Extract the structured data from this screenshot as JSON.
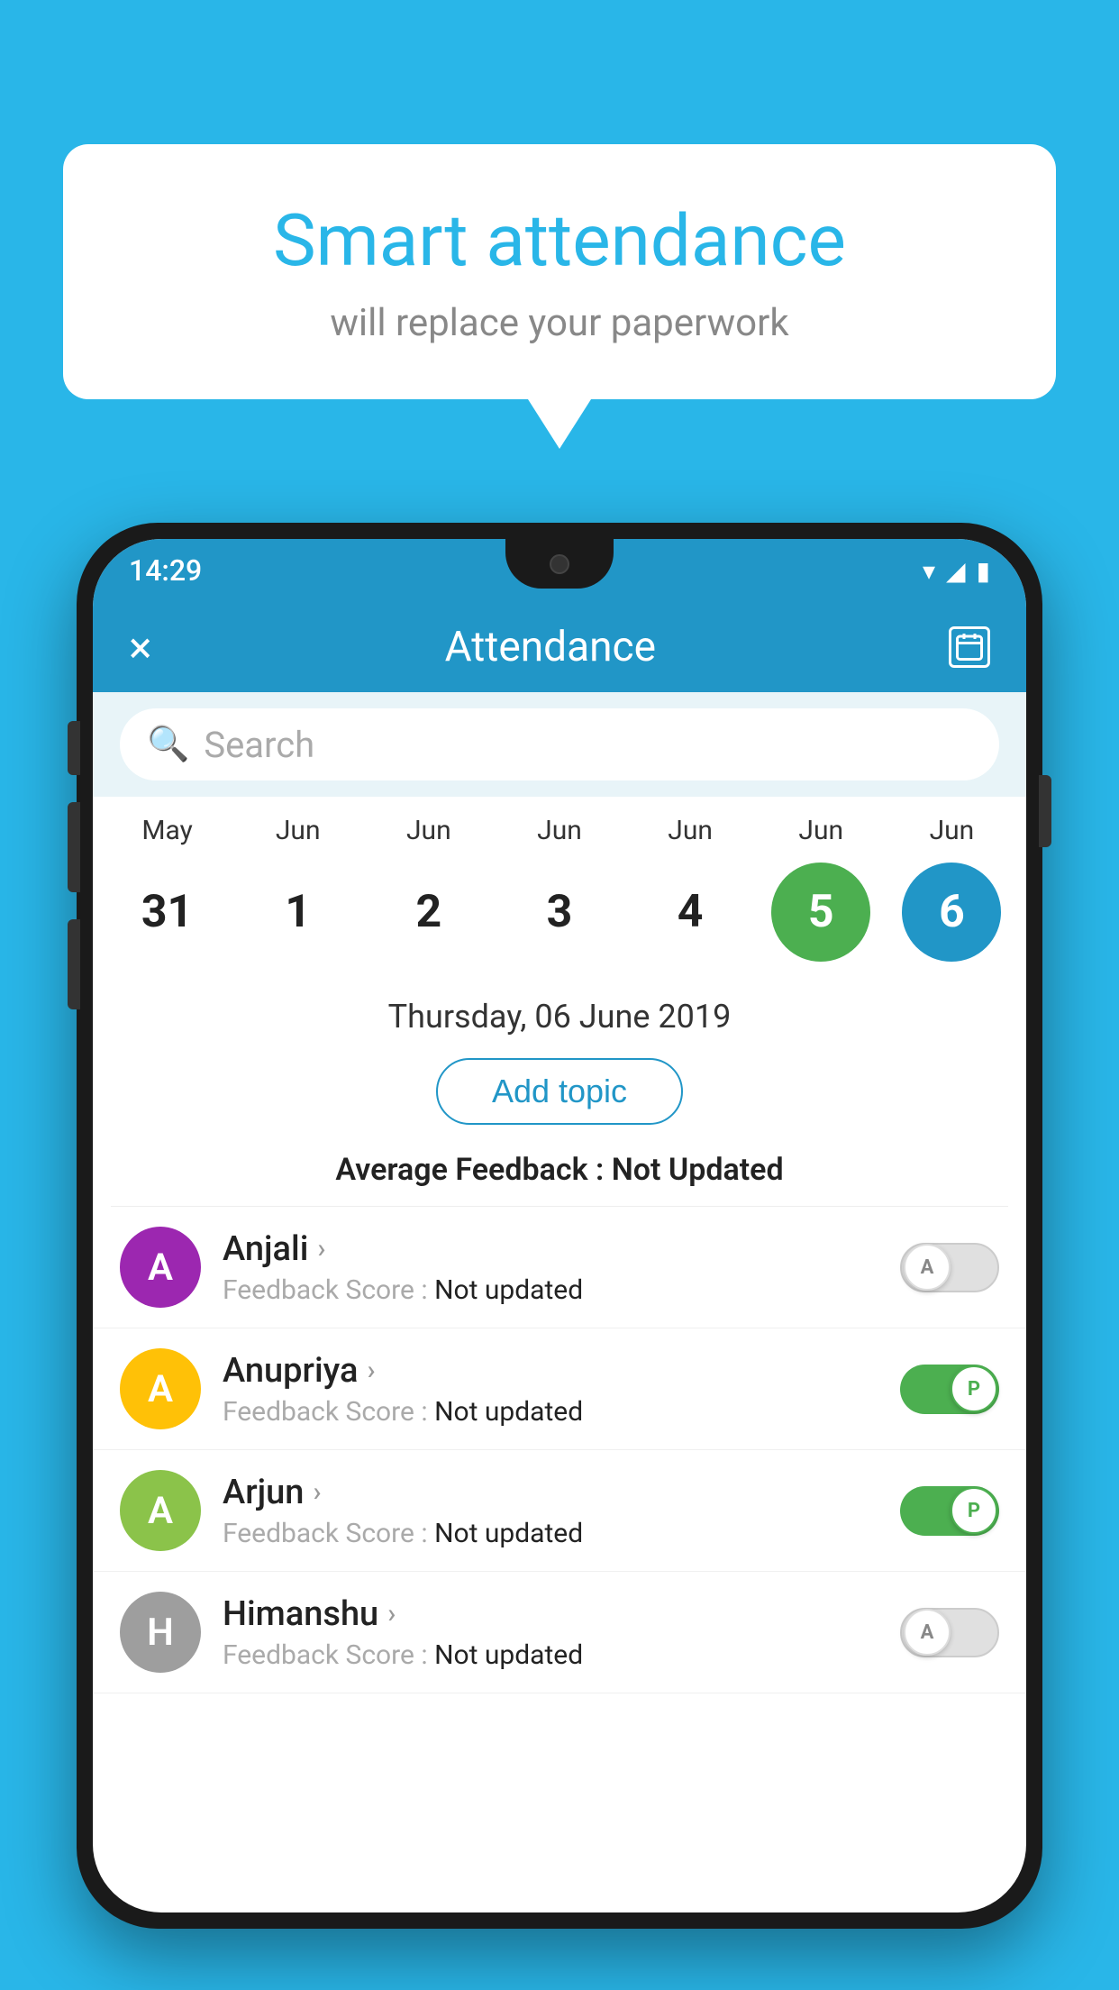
{
  "background_color": "#29b6e8",
  "speech_bubble": {
    "title": "Smart attendance",
    "subtitle": "will replace your paperwork"
  },
  "status_bar": {
    "time": "14:29",
    "wifi_icon": "▾",
    "signal_icon": "◢",
    "battery_icon": "▮"
  },
  "app_bar": {
    "close_label": "×",
    "title": "Attendance",
    "calendar_icon_label": "📅"
  },
  "search": {
    "placeholder": "Search"
  },
  "calendar": {
    "months": [
      "May",
      "Jun",
      "Jun",
      "Jun",
      "Jun",
      "Jun",
      "Jun"
    ],
    "dates": [
      "31",
      "1",
      "2",
      "3",
      "4",
      "5",
      "6"
    ],
    "states": [
      "normal",
      "normal",
      "normal",
      "normal",
      "normal",
      "today",
      "selected"
    ]
  },
  "selected_date": "Thursday, 06 June 2019",
  "add_topic_label": "Add topic",
  "average_feedback": {
    "label": "Average Feedback : ",
    "value": "Not Updated"
  },
  "students": [
    {
      "name": "Anjali",
      "avatar_letter": "A",
      "avatar_color": "#9c27b0",
      "feedback_label": "Feedback Score : ",
      "feedback_value": "Not updated",
      "toggle_state": "off",
      "toggle_label": "A"
    },
    {
      "name": "Anupriya",
      "avatar_letter": "A",
      "avatar_color": "#ffc107",
      "feedback_label": "Feedback Score : ",
      "feedback_value": "Not updated",
      "toggle_state": "on",
      "toggle_label": "P"
    },
    {
      "name": "Arjun",
      "avatar_letter": "A",
      "avatar_color": "#8bc34a",
      "feedback_label": "Feedback Score : ",
      "feedback_value": "Not updated",
      "toggle_state": "on",
      "toggle_label": "P"
    },
    {
      "name": "Himanshu",
      "avatar_letter": "H",
      "avatar_color": "#9e9e9e",
      "feedback_label": "Feedback Score : ",
      "feedback_value": "Not updated",
      "toggle_state": "off",
      "toggle_label": "A"
    }
  ]
}
